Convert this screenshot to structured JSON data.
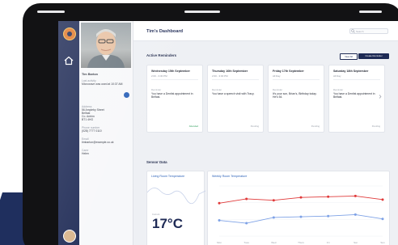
{
  "page": {
    "title": "Tim's Dashboard",
    "search_placeholder": "Search"
  },
  "profile": {
    "name": "Tim Barton",
    "last_activity_label": "Last activity",
    "last_activity": "Microwave was used at 10:37 AM",
    "address_label": "Address",
    "address_lines": [
      "56 Ampleby Street",
      "Belfast",
      "Co. Antrim",
      "BT1 4HG"
    ],
    "phone_label": "Phone number",
    "phone": "(028) 7777 0110",
    "email_label": "Email",
    "email": "timbarton@example.co.uk",
    "carer_label": "Carer",
    "carer": "Helen"
  },
  "reminders": {
    "section_title": "Active Reminders",
    "view_all_label": "View All",
    "create_label": "Create Reminder",
    "cards": [
      {
        "date": "Wednesday 15th September",
        "time": "2:00 - 3:30 PM",
        "type": "Reminder",
        "message": "You have a Dentist appointment in Belfast.",
        "status": "Attended",
        "status_color": "#2e9e5b"
      },
      {
        "date": "Thursday 16th September",
        "time": "2:00 - 3:00 PM",
        "type": "Reminder",
        "message": "You have a speech visit with Tracy.",
        "status": "Pending",
        "status_color": "#9aa0aa"
      },
      {
        "date": "Friday 17th September",
        "time": "All Day",
        "type": "Reminder",
        "message": "It's your son, Brian's, Birthday today. He's 54.",
        "status": "Pending",
        "status_color": "#9aa0aa"
      },
      {
        "date": "Saturday 18th September",
        "time": "All Day",
        "type": "Reminder",
        "message": "You have a Dentist appointment in Belfast.",
        "status": "Pending",
        "status_color": "#9aa0aa"
      }
    ]
  },
  "sensors": {
    "section_title": "Sensor Data",
    "living_room": {
      "title": "Living Room Temperature",
      "current_label": "Current",
      "current": "17°C"
    },
    "weekly": {
      "title": "Weekly Room Temperature"
    }
  },
  "chart_data": {
    "type": "line",
    "title": "Weekly Room Temperature",
    "categories": [
      "Mon",
      "Tues",
      "Wed",
      "Thurs",
      "Fri",
      "Sat",
      "Sun"
    ],
    "series": [
      {
        "values": [
          18.6,
          19.2,
          19.0,
          19.4,
          19.5,
          19.6,
          19.1
        ],
        "color": "#e03a3a"
      },
      {
        "values": [
          16.2,
          15.8,
          16.6,
          16.7,
          16.8,
          17.0,
          16.4
        ],
        "color": "#7ea2e6"
      }
    ],
    "ylim": [
      14,
      21
    ]
  },
  "colors": {
    "brand_navy": "#1e2a55",
    "accent_blue": "#2c62b8"
  }
}
